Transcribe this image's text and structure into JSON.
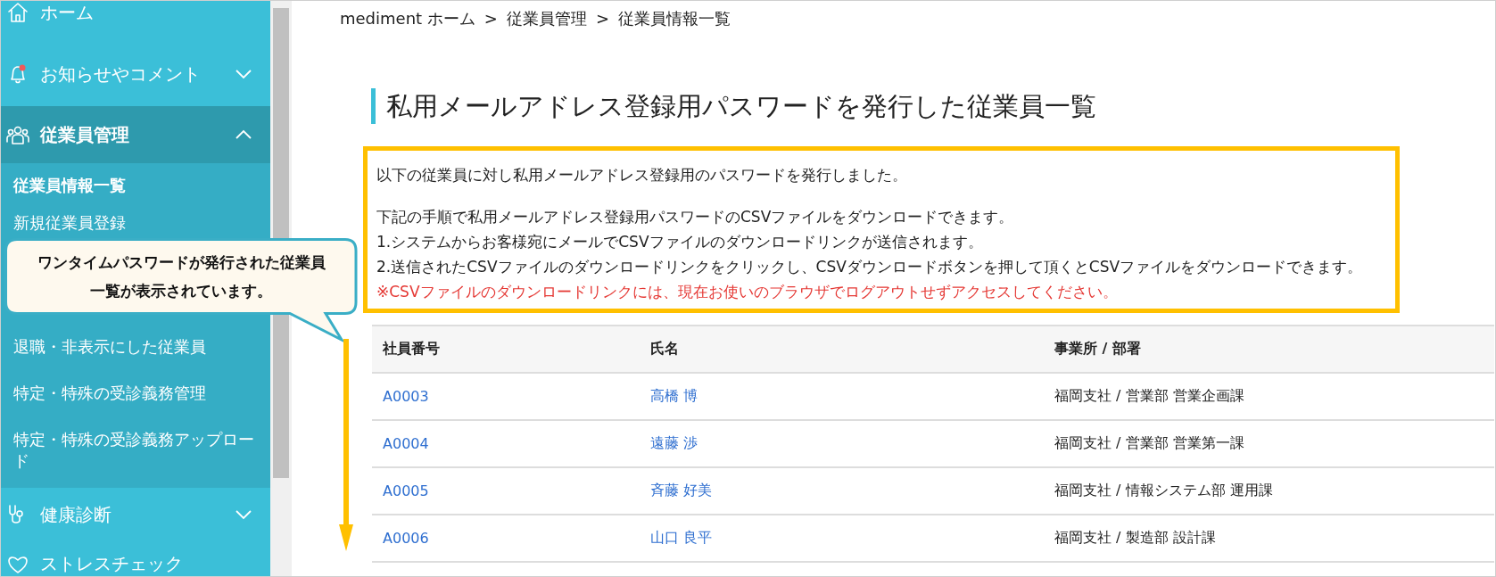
{
  "sidebar": {
    "items": [
      {
        "label": "ホーム"
      },
      {
        "label": "お知らせやコメント",
        "expanded": false
      },
      {
        "label": "従業員管理",
        "expanded": true,
        "children": [
          {
            "label": "従業員情報一覧",
            "selected": true
          },
          {
            "label": "新規従業員登録",
            "selected": false
          },
          {
            "label": "退職・非表示にした従業員",
            "selected": false
          },
          {
            "label": "特定・特殊の受診義務管理",
            "selected": false
          },
          {
            "label": "特定・特殊の受診義務アップロード",
            "selected": false
          }
        ]
      },
      {
        "label": "健康診断",
        "expanded": false
      },
      {
        "label": "ストレスチェック"
      }
    ]
  },
  "breadcrumb": [
    "mediment ホーム",
    ">",
    "従業員管理",
    ">",
    "従業員情報一覧"
  ],
  "page_title": "私用メールアドレス登録用パスワードを発行した従業員一覧",
  "notice": {
    "lines": [
      {
        "kind": "lead",
        "text": "以下の従業員に対し私用メールアドレス登録用のパスワードを発行しました。"
      },
      {
        "kind": "normal",
        "text": "下記の手順で私用メールアドレス登録用パスワードのCSVファイルをダウンロードできます。"
      },
      {
        "kind": "normal",
        "text": "1.システムからお客様宛にメールでCSVファイルのダウンロードリンクが送信されます。"
      },
      {
        "kind": "normal",
        "text": "2.送信されたCSVファイルのダウンロードリンクをクリックし、CSVダウンロードボタンを押して頂くとCSVファイルをダウンロードできます。"
      },
      {
        "kind": "warning",
        "text": "※CSVファイルのダウンロードリンクには、現在お使いのブラウザでログアウトせずアクセスしてください。"
      }
    ]
  },
  "table": {
    "columns": [
      "社員番号",
      "氏名",
      "事業所 / 部署"
    ],
    "rows": [
      [
        "A0003",
        "高橋 博",
        "福岡支社 / 営業部 営業企画課"
      ],
      [
        "A0004",
        "遠藤 渉",
        "福岡支社 / 営業部 営業第一課"
      ],
      [
        "A0005",
        "斉藤 好美",
        "福岡支社 / 情報システム部 運用課"
      ],
      [
        "A0006",
        "山口 良平",
        "福岡支社 / 製造部 設計課"
      ]
    ]
  },
  "callout": {
    "text": "ワンタイムパスワードが発行された従業員一覧が表示されています。"
  }
}
